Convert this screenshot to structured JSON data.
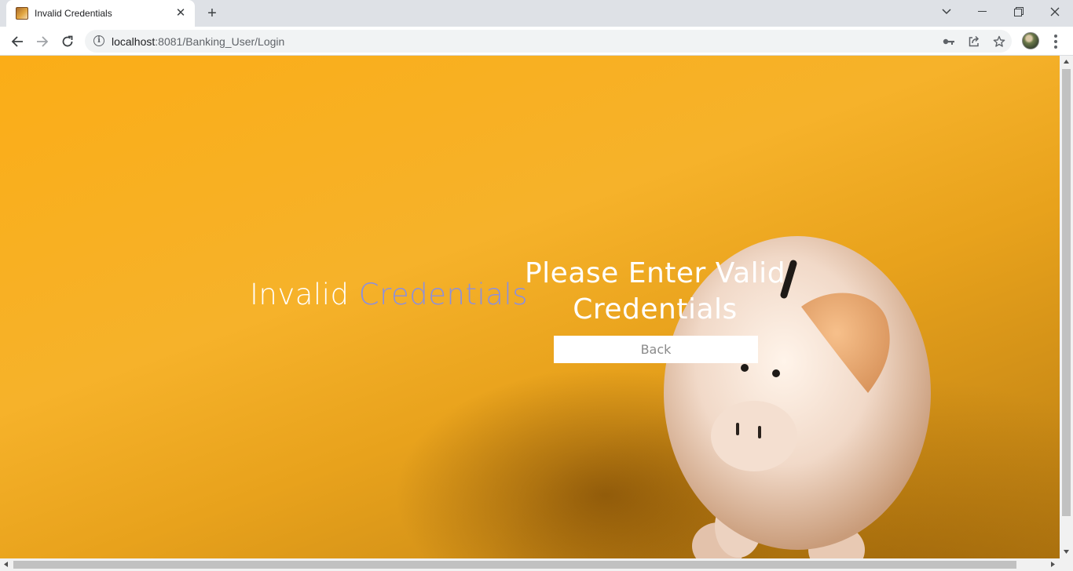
{
  "browser": {
    "tab_title": "Invalid Credentials",
    "new_tab_symbol": "+",
    "url_host": "localhost",
    "url_port": ":8081",
    "url_path": "/Banking_User/Login",
    "icons": [
      "back-arrow-icon",
      "forward-arrow-icon",
      "reload-icon",
      "info-icon",
      "key-icon",
      "share-icon",
      "star-icon",
      "avatar",
      "menu-icon",
      "tab-search-icon",
      "minimize-icon",
      "restore-icon",
      "close-icon"
    ]
  },
  "page": {
    "left_heading_plain": "Invalid ",
    "left_heading_accent": "Credentials",
    "right_heading": "Please Enter Valid Credentials",
    "back_button_label": "Back",
    "accent_color": "#8a8fe0",
    "background_color": "#f6b22a"
  }
}
